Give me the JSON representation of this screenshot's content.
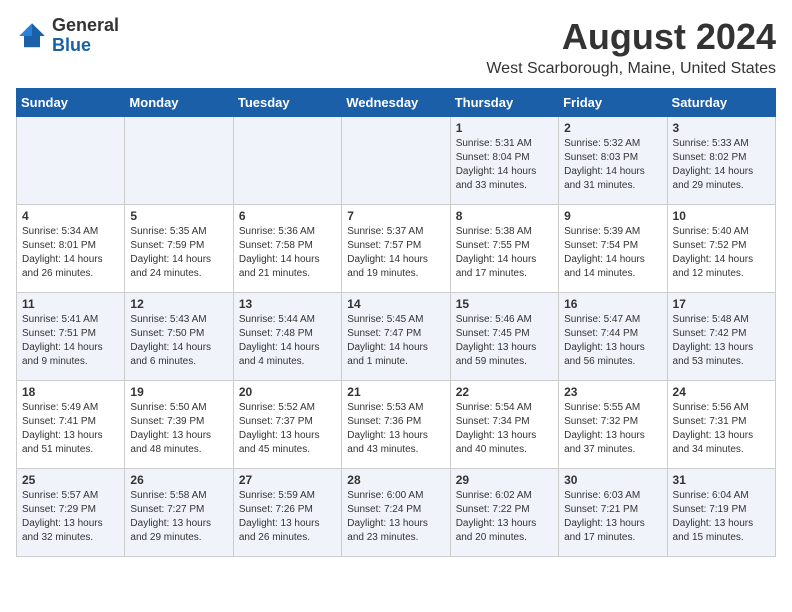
{
  "logo": {
    "general": "General",
    "blue": "Blue"
  },
  "header": {
    "month_year": "August 2024",
    "location": "West Scarborough, Maine, United States"
  },
  "days_of_week": [
    "Sunday",
    "Monday",
    "Tuesday",
    "Wednesday",
    "Thursday",
    "Friday",
    "Saturday"
  ],
  "weeks": [
    [
      {
        "day": "",
        "info": ""
      },
      {
        "day": "",
        "info": ""
      },
      {
        "day": "",
        "info": ""
      },
      {
        "day": "",
        "info": ""
      },
      {
        "day": "1",
        "info": "Sunrise: 5:31 AM\nSunset: 8:04 PM\nDaylight: 14 hours\nand 33 minutes."
      },
      {
        "day": "2",
        "info": "Sunrise: 5:32 AM\nSunset: 8:03 PM\nDaylight: 14 hours\nand 31 minutes."
      },
      {
        "day": "3",
        "info": "Sunrise: 5:33 AM\nSunset: 8:02 PM\nDaylight: 14 hours\nand 29 minutes."
      }
    ],
    [
      {
        "day": "4",
        "info": "Sunrise: 5:34 AM\nSunset: 8:01 PM\nDaylight: 14 hours\nand 26 minutes."
      },
      {
        "day": "5",
        "info": "Sunrise: 5:35 AM\nSunset: 7:59 PM\nDaylight: 14 hours\nand 24 minutes."
      },
      {
        "day": "6",
        "info": "Sunrise: 5:36 AM\nSunset: 7:58 PM\nDaylight: 14 hours\nand 21 minutes."
      },
      {
        "day": "7",
        "info": "Sunrise: 5:37 AM\nSunset: 7:57 PM\nDaylight: 14 hours\nand 19 minutes."
      },
      {
        "day": "8",
        "info": "Sunrise: 5:38 AM\nSunset: 7:55 PM\nDaylight: 14 hours\nand 17 minutes."
      },
      {
        "day": "9",
        "info": "Sunrise: 5:39 AM\nSunset: 7:54 PM\nDaylight: 14 hours\nand 14 minutes."
      },
      {
        "day": "10",
        "info": "Sunrise: 5:40 AM\nSunset: 7:52 PM\nDaylight: 14 hours\nand 12 minutes."
      }
    ],
    [
      {
        "day": "11",
        "info": "Sunrise: 5:41 AM\nSunset: 7:51 PM\nDaylight: 14 hours\nand 9 minutes."
      },
      {
        "day": "12",
        "info": "Sunrise: 5:43 AM\nSunset: 7:50 PM\nDaylight: 14 hours\nand 6 minutes."
      },
      {
        "day": "13",
        "info": "Sunrise: 5:44 AM\nSunset: 7:48 PM\nDaylight: 14 hours\nand 4 minutes."
      },
      {
        "day": "14",
        "info": "Sunrise: 5:45 AM\nSunset: 7:47 PM\nDaylight: 14 hours\nand 1 minute."
      },
      {
        "day": "15",
        "info": "Sunrise: 5:46 AM\nSunset: 7:45 PM\nDaylight: 13 hours\nand 59 minutes."
      },
      {
        "day": "16",
        "info": "Sunrise: 5:47 AM\nSunset: 7:44 PM\nDaylight: 13 hours\nand 56 minutes."
      },
      {
        "day": "17",
        "info": "Sunrise: 5:48 AM\nSunset: 7:42 PM\nDaylight: 13 hours\nand 53 minutes."
      }
    ],
    [
      {
        "day": "18",
        "info": "Sunrise: 5:49 AM\nSunset: 7:41 PM\nDaylight: 13 hours\nand 51 minutes."
      },
      {
        "day": "19",
        "info": "Sunrise: 5:50 AM\nSunset: 7:39 PM\nDaylight: 13 hours\nand 48 minutes."
      },
      {
        "day": "20",
        "info": "Sunrise: 5:52 AM\nSunset: 7:37 PM\nDaylight: 13 hours\nand 45 minutes."
      },
      {
        "day": "21",
        "info": "Sunrise: 5:53 AM\nSunset: 7:36 PM\nDaylight: 13 hours\nand 43 minutes."
      },
      {
        "day": "22",
        "info": "Sunrise: 5:54 AM\nSunset: 7:34 PM\nDaylight: 13 hours\nand 40 minutes."
      },
      {
        "day": "23",
        "info": "Sunrise: 5:55 AM\nSunset: 7:32 PM\nDaylight: 13 hours\nand 37 minutes."
      },
      {
        "day": "24",
        "info": "Sunrise: 5:56 AM\nSunset: 7:31 PM\nDaylight: 13 hours\nand 34 minutes."
      }
    ],
    [
      {
        "day": "25",
        "info": "Sunrise: 5:57 AM\nSunset: 7:29 PM\nDaylight: 13 hours\nand 32 minutes."
      },
      {
        "day": "26",
        "info": "Sunrise: 5:58 AM\nSunset: 7:27 PM\nDaylight: 13 hours\nand 29 minutes."
      },
      {
        "day": "27",
        "info": "Sunrise: 5:59 AM\nSunset: 7:26 PM\nDaylight: 13 hours\nand 26 minutes."
      },
      {
        "day": "28",
        "info": "Sunrise: 6:00 AM\nSunset: 7:24 PM\nDaylight: 13 hours\nand 23 minutes."
      },
      {
        "day": "29",
        "info": "Sunrise: 6:02 AM\nSunset: 7:22 PM\nDaylight: 13 hours\nand 20 minutes."
      },
      {
        "day": "30",
        "info": "Sunrise: 6:03 AM\nSunset: 7:21 PM\nDaylight: 13 hours\nand 17 minutes."
      },
      {
        "day": "31",
        "info": "Sunrise: 6:04 AM\nSunset: 7:19 PM\nDaylight: 13 hours\nand 15 minutes."
      }
    ]
  ]
}
